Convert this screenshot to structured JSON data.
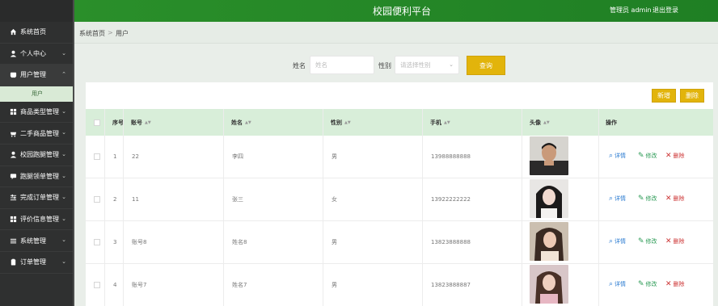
{
  "header": {
    "title": "校园便利平台",
    "user": "管理员 admin",
    "logout": "退出登录"
  },
  "sidebar": {
    "items": [
      {
        "label": "系统首页",
        "icon": "home-icon"
      },
      {
        "label": "个人中心",
        "icon": "person-icon"
      },
      {
        "label": "用户管理",
        "icon": "user-card-icon"
      },
      {
        "label": "商品类型管理",
        "icon": "grid-icon"
      },
      {
        "label": "二手商品管理",
        "icon": "cart-icon"
      },
      {
        "label": "校园跑腿管理",
        "icon": "person-icon"
      },
      {
        "label": "跑腿领单管理",
        "icon": "message-icon"
      },
      {
        "label": "完成订单管理",
        "icon": "sliders-icon"
      },
      {
        "label": "评价信息管理",
        "icon": "grid-icon"
      },
      {
        "label": "系统管理",
        "icon": "menu-icon"
      },
      {
        "label": "订单管理",
        "icon": "clipboard-icon"
      }
    ],
    "sub_item": "用户"
  },
  "breadcrumb": {
    "home": "系统首页",
    "sep": ">",
    "current": "用户"
  },
  "search": {
    "name_label": "姓名",
    "name_placeholder": "姓名",
    "gender_label": "性别",
    "gender_placeholder": "请选择性别",
    "query_btn": "查询"
  },
  "actions": {
    "add": "新增",
    "delete": "删除"
  },
  "table": {
    "headers": {
      "index": "序号",
      "account": "账号",
      "name": "姓名",
      "gender": "性别",
      "phone": "手机",
      "avatar": "头像",
      "ops": "操作"
    },
    "ops": {
      "detail": "详情",
      "edit": "修改",
      "delete": "删除"
    },
    "rows": [
      {
        "index": "1",
        "account": "22",
        "name": "李四",
        "gender": "男",
        "phone": "13988888888"
      },
      {
        "index": "2",
        "account": "11",
        "name": "张三",
        "gender": "女",
        "phone": "13922222222"
      },
      {
        "index": "3",
        "account": "账号8",
        "name": "姓名8",
        "gender": "男",
        "phone": "13823888888"
      },
      {
        "index": "4",
        "account": "账号7",
        "name": "姓名7",
        "gender": "男",
        "phone": "13823888887"
      }
    ]
  }
}
